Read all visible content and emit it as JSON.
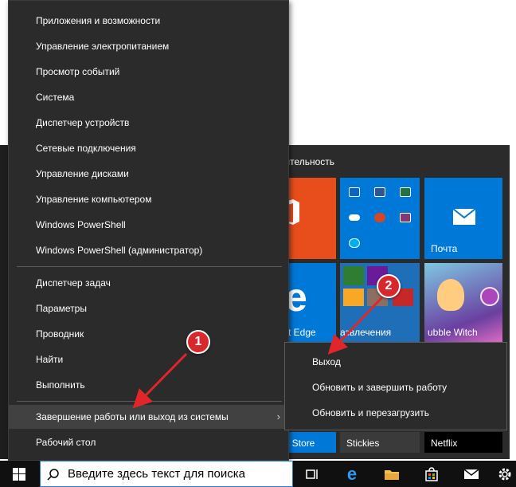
{
  "menu": {
    "items": [
      {
        "label": "Приложения и возможности"
      },
      {
        "label": "Управление электропитанием"
      },
      {
        "label": "Просмотр событий"
      },
      {
        "label": "Система"
      },
      {
        "label": "Диспетчер устройств"
      },
      {
        "label": "Сетевые подключения"
      },
      {
        "label": "Управление дисками"
      },
      {
        "label": "Управление компьютером"
      },
      {
        "label": "Windows PowerShell"
      },
      {
        "label": "Windows PowerShell (администратор)"
      }
    ],
    "items2": [
      {
        "label": "Диспетчер задач"
      },
      {
        "label": "Параметры"
      },
      {
        "label": "Проводник"
      },
      {
        "label": "Найти"
      },
      {
        "label": "Выполнить"
      }
    ],
    "shutdown_label": "Завершение работы или выход из системы",
    "desktop_label": "Рабочий стол",
    "chevron": "›"
  },
  "submenu": {
    "items": [
      {
        "label": "Выход"
      },
      {
        "label": "Обновить и завершить работу"
      },
      {
        "label": "Обновить и перезагрузить"
      }
    ]
  },
  "start": {
    "group_title": "одительность",
    "tiles": {
      "mail": "Почта",
      "edge": "soft Edge",
      "entertainment": "азвлечения",
      "bubble": "ubble Witch",
      "store": "soft Store",
      "stickies": "Stickies",
      "netflix": "Netflix"
    },
    "edge_glyph": "e"
  },
  "annotations": {
    "badge1": "1",
    "badge2": "2"
  },
  "taskbar": {
    "search_placeholder": "Введите здесь текст для поиска"
  },
  "colors": {
    "menu_bg": "#2b2b2b",
    "accent": "#0078d7",
    "office": "#e74e1c",
    "badge": "#d9282c"
  },
  "icons": [
    "windows-icon",
    "search-icon",
    "task-view-icon",
    "edge-icon",
    "file-explorer-icon",
    "store-icon",
    "mail-icon",
    "settings-icon"
  ]
}
